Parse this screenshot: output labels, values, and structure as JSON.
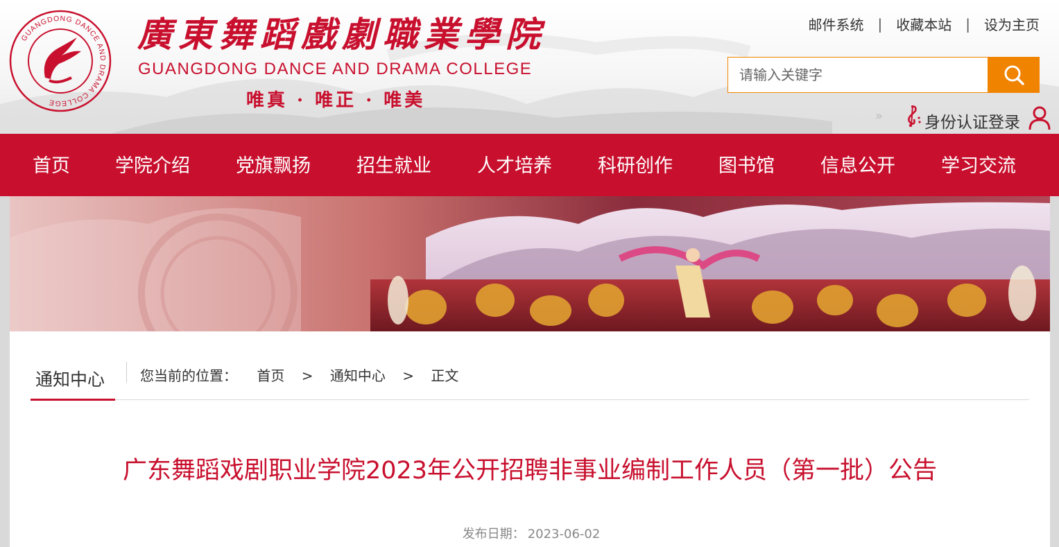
{
  "school": {
    "cn_name": "廣東舞蹈戲劇職業學院",
    "en_name": "GUANGDONG DANCE AND DRAMA COLLEGE",
    "motto": "唯真 · 唯正 · 唯美",
    "seal_text": "GUANGDONG DANCE AND DRAMA COLLEGE"
  },
  "top_links": [
    "邮件系统",
    "收藏本站",
    "设为主页"
  ],
  "search": {
    "placeholder": "请输入关键字",
    "icon": "search-icon"
  },
  "login": {
    "label": "身份认证登录",
    "icon": "user-icon"
  },
  "nav": {
    "items": [
      "首页",
      "学院介绍",
      "党旗飘扬",
      "招生就业",
      "人才培养",
      "科研创作",
      "图书馆",
      "信息公开",
      "学习交流"
    ],
    "active_index": 7
  },
  "section": {
    "title": "通知中心",
    "location_label": "您当前的位置：",
    "breadcrumb": [
      "首页",
      "通知中心",
      "正文"
    ]
  },
  "article": {
    "title": "广东舞蹈戏剧职业学院2023年公开招聘非事业编制工作人员（第一批）公告",
    "date_label": "发布日期：",
    "date": "2023-06-02"
  },
  "colors": {
    "brand_red": "#c8102e",
    "accent_orange": "#f08300"
  }
}
